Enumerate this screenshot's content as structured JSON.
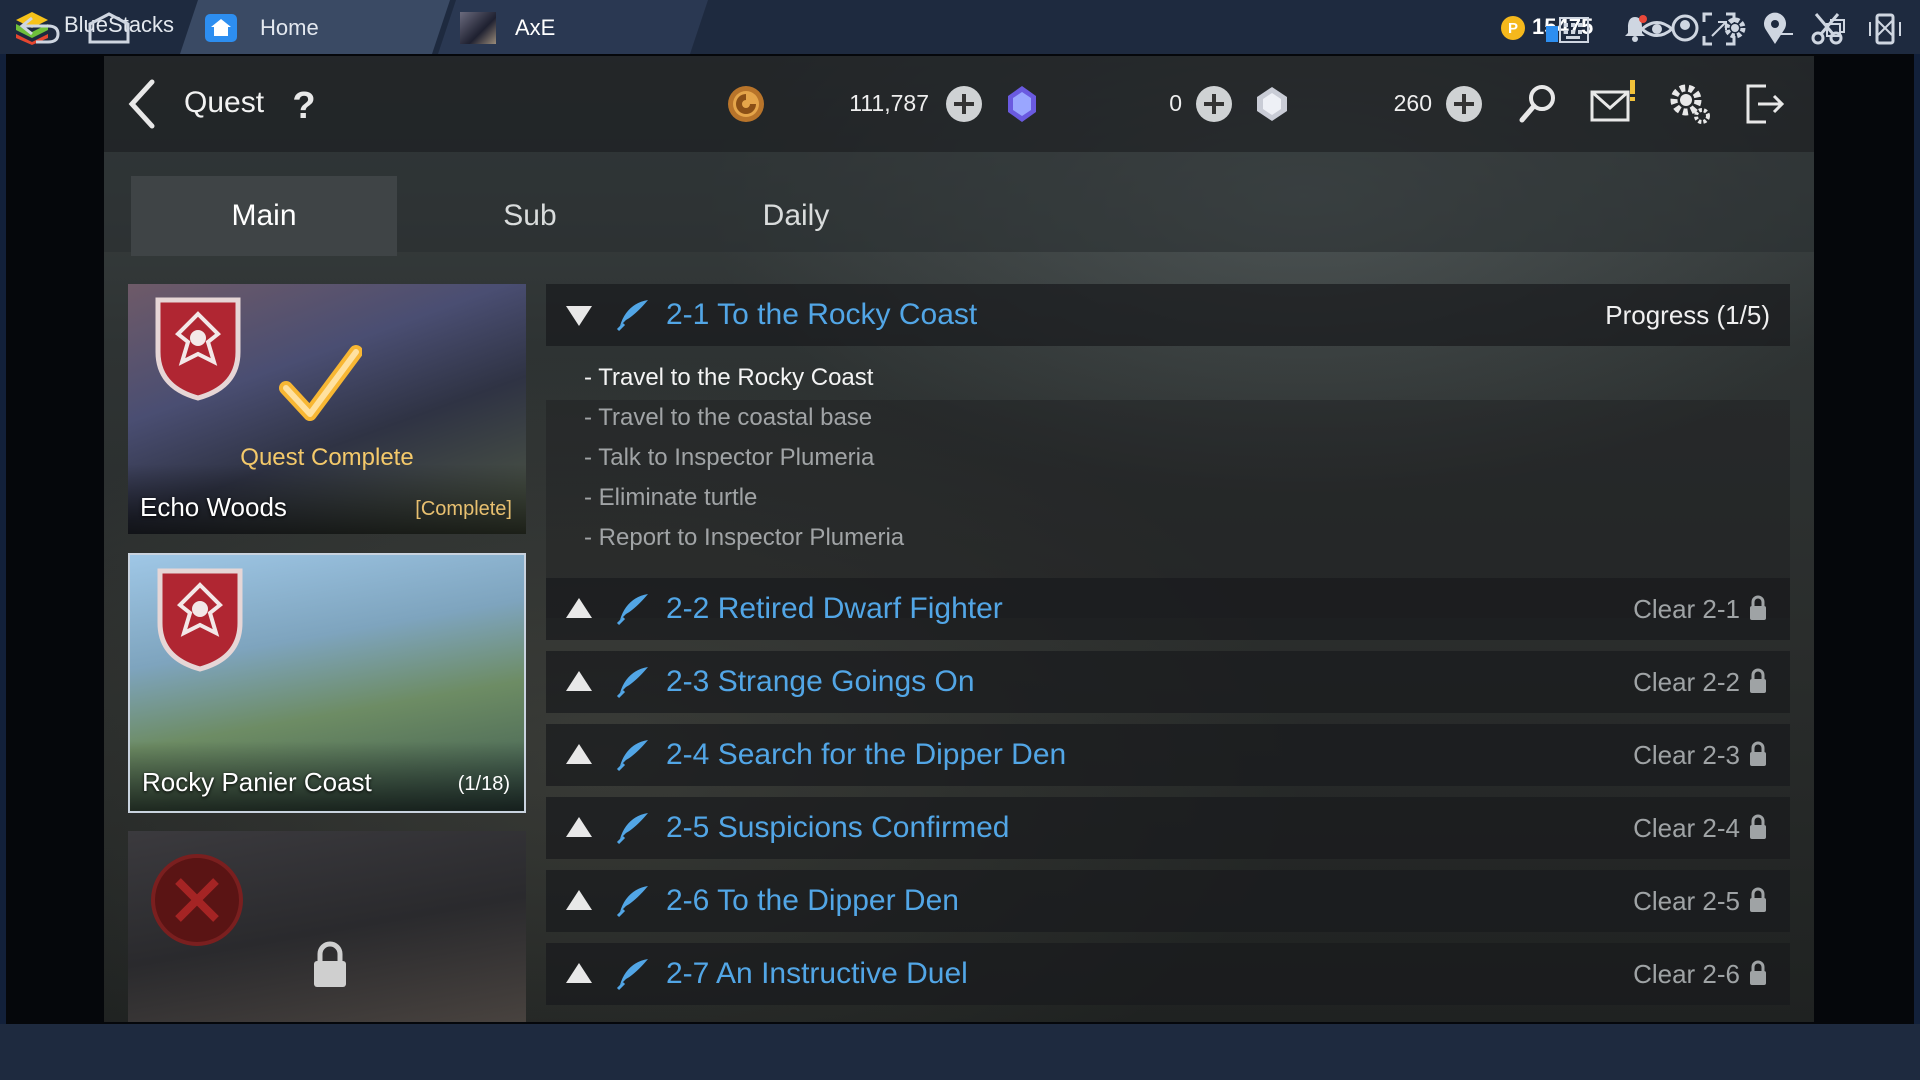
{
  "emulator": {
    "app_name": "BlueStacks",
    "tabs": [
      {
        "label": "Home",
        "icon": "home-icon"
      },
      {
        "label": "AxE",
        "icon": "game-thumbnail-icon"
      }
    ],
    "coins": "15475",
    "title_icons": [
      "bell-icon",
      "account-icon",
      "settings-gear-icon",
      "minimize-icon",
      "restore-icon",
      "close-icon"
    ],
    "bottom_icons": [
      "back-arrow-icon",
      "home-outline-icon",
      "keyboard-icon",
      "eye-icon",
      "fullscreen-icon",
      "location-pin-icon",
      "scissors-icon",
      "rotate-device-icon"
    ],
    "colors": {
      "bar": "#1e2a3f",
      "accent_coin": "#f5b81c"
    }
  },
  "game": {
    "header": {
      "title": "Quest",
      "help_icon": "question-mark-icon",
      "currencies": [
        {
          "icon": "gold-coin-icon",
          "value": "111,787"
        },
        {
          "icon": "blue-gem-icon",
          "value": "0"
        },
        {
          "icon": "white-crystal-icon",
          "value": "260"
        }
      ],
      "right_icons": [
        "search-icon",
        "mail-icon",
        "settings-icon",
        "exit-icon"
      ]
    },
    "tabs": [
      {
        "label": "Main",
        "active": true
      },
      {
        "label": "Sub",
        "active": false
      },
      {
        "label": "Daily",
        "active": false
      }
    ],
    "regions": [
      {
        "name": "Echo Woods",
        "badge": "[Complete]",
        "overlay": "Quest Complete",
        "badge_color": "#e8c070"
      },
      {
        "name": "Rocky Panier Coast",
        "badge": "(1/18)",
        "badge_color": "#ffffff"
      },
      {
        "name": "",
        "badge": "",
        "locked": true
      }
    ],
    "quests": [
      {
        "title": "2-1 To the Rocky Coast",
        "status": "Progress (1/5)",
        "expanded": true
      },
      {
        "title": "2-2 Retired Dwarf Fighter",
        "status": "Clear 2-1",
        "locked": true
      },
      {
        "title": "2-3 Strange Goings On",
        "status": "Clear 2-2",
        "locked": true
      },
      {
        "title": "2-4 Search for the Dipper Den",
        "status": "Clear 2-3",
        "locked": true
      },
      {
        "title": "2-5 Suspicions Confirmed",
        "status": "Clear 2-4",
        "locked": true
      },
      {
        "title": "2-6 To the Dipper Den",
        "status": "Clear 2-5",
        "locked": true
      },
      {
        "title": "2-7 An Instructive Duel",
        "status": "Clear 2-6",
        "locked": true
      }
    ],
    "steps": [
      {
        "text": "- Travel to the Rocky Coast",
        "done": false,
        "current": true
      },
      {
        "text": "- Travel to the coastal base",
        "current": false
      },
      {
        "text": "- Talk to Inspector Plumeria",
        "current": false
      },
      {
        "text": "- Eliminate turtle",
        "current": false
      },
      {
        "text": "- Report to Inspector Plumeria",
        "current": false
      }
    ],
    "colors": {
      "quest_title": "#52a6e6",
      "step_active": "#f4f4f4",
      "step_inactive": "#a1a4a6"
    }
  }
}
